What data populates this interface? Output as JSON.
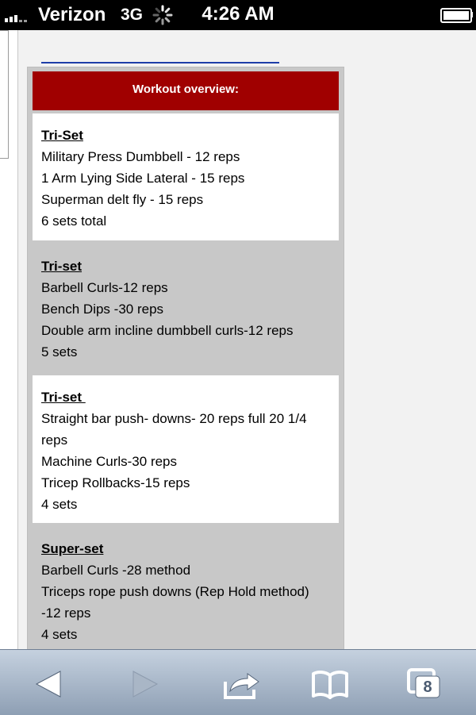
{
  "status": {
    "carrier": "Verizon",
    "network": "3G",
    "time": "4:26 AM"
  },
  "workout": {
    "header": "Workout overview:",
    "blocks": [
      {
        "title": "Tri-Set",
        "lines": [
          "Military Press Dumbbell - 12 reps",
          "1 Arm Lying Side Lateral - 15 reps",
          "Superman delt fly - 15 reps",
          "6 sets total"
        ]
      },
      {
        "title": "Tri-set",
        "lines": [
          "Barbell Curls-12 reps",
          "Bench Dips -30 reps",
          "Double arm incline dumbbell curls-12 reps",
          "5 sets"
        ]
      },
      {
        "title": "Tri-set ",
        "lines": [
          "Straight bar push- downs- 20 reps full 20 1/4",
          "reps",
          "Machine Curls-30 reps",
          "Tricep Rollbacks-15 reps",
          "4 sets"
        ]
      },
      {
        "title": "Super-set",
        "lines": [
          "Barbell Curls -28 method",
          "Triceps rope push downs (Rep Hold method)",
          "-12 reps",
          "4 sets"
        ]
      }
    ]
  },
  "toolbar": {
    "tabs_count": "8",
    "icons": [
      "back-arrow-icon",
      "forward-arrow-icon",
      "share-icon",
      "bookmarks-icon",
      "tabs-icon"
    ]
  }
}
